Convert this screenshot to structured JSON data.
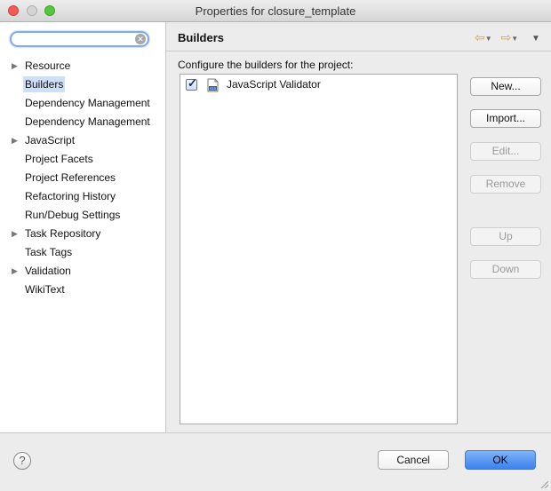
{
  "window": {
    "title": "Properties for closure_template"
  },
  "search": {
    "placeholder": "",
    "value": "",
    "clear_icon": "clear-search-icon"
  },
  "sidebar": {
    "items": [
      {
        "label": "Resource",
        "expandable": true,
        "selected": false
      },
      {
        "label": "Builders",
        "expandable": false,
        "selected": true
      },
      {
        "label": "Dependency Management",
        "expandable": false,
        "selected": false
      },
      {
        "label": "Dependency Management",
        "expandable": false,
        "selected": false
      },
      {
        "label": "JavaScript",
        "expandable": true,
        "selected": false
      },
      {
        "label": "Project Facets",
        "expandable": false,
        "selected": false
      },
      {
        "label": "Project References",
        "expandable": false,
        "selected": false
      },
      {
        "label": "Refactoring History",
        "expandable": false,
        "selected": false
      },
      {
        "label": "Run/Debug Settings",
        "expandable": false,
        "selected": false
      },
      {
        "label": "Task Repository",
        "expandable": true,
        "selected": false
      },
      {
        "label": "Task Tags",
        "expandable": false,
        "selected": false
      },
      {
        "label": "Validation",
        "expandable": true,
        "selected": false
      },
      {
        "label": "WikiText",
        "expandable": false,
        "selected": false
      }
    ]
  },
  "main": {
    "title": "Builders",
    "description": "Configure the builders for the project:",
    "builders": [
      {
        "label": "JavaScript Validator",
        "checked": true,
        "icon": "binary-file-icon"
      }
    ],
    "buttons": {
      "new": "New...",
      "import": "Import...",
      "edit": "Edit...",
      "remove": "Remove",
      "up": "Up",
      "down": "Down"
    }
  },
  "footer": {
    "help": "?",
    "cancel": "Cancel",
    "ok": "OK"
  },
  "colors": {
    "accent": "#3a82ef",
    "selection": "#cfdff7",
    "nav_arrow": "#e2a22a"
  }
}
